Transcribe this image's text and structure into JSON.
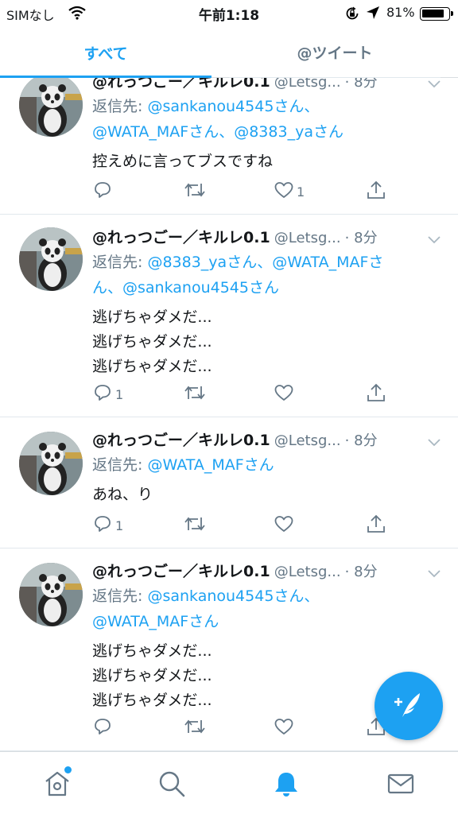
{
  "status_bar": {
    "carrier": "SIMなし",
    "time": "午前1:18",
    "battery_percent": "81%",
    "battery_level": 0.81
  },
  "tabs": [
    {
      "label": "すべて",
      "selected": true
    },
    {
      "label": "@ツイート",
      "selected": false
    }
  ],
  "tweets": [
    {
      "name": "@れっつごー／キルレ0.1",
      "handle": "@Letsg...",
      "time": "· 8分",
      "reply_prefix": "返信先: ",
      "reply_mentions": "@sankanou4545さん、",
      "reply_line2": "@WATA_MAFさん、@8383_yaさん",
      "text": "控えめに言ってブスですね",
      "reply_count": "",
      "like_count": "1"
    },
    {
      "name": "@れっつごー／キルレ0.1",
      "handle": "@Letsg...",
      "time": "· 8分",
      "reply_prefix": "返信先: ",
      "reply_mentions": "@8383_yaさん、@WATA_MAFさ",
      "reply_line2": "ん、@sankanou4545さん",
      "text_lines": [
        "逃げちゃダメだ...",
        "逃げちゃダメだ...",
        "逃げちゃダメだ..."
      ],
      "reply_count": "1",
      "like_count": ""
    },
    {
      "name": "@れっつごー／キルレ0.1",
      "handle": "@Letsg...",
      "time": "· 8分",
      "reply_prefix": "返信先: ",
      "reply_mentions": "@WATA_MAFさん",
      "text": "あね、り",
      "reply_count": "1",
      "like_count": ""
    },
    {
      "name": "@れっつごー／キルレ0.1",
      "handle": "@Letsg...",
      "time": "· 8分",
      "reply_prefix": "返信先: ",
      "reply_mentions": "@sankanou4545さん、",
      "reply_line2": "@WATA_MAFさん",
      "text_lines": [
        "逃げちゃダメだ...",
        "逃げちゃダメだ...",
        "逃げちゃダメだ..."
      ],
      "reply_count": "",
      "like_count": ""
    }
  ],
  "colors": {
    "accent": "#1da1f2",
    "secondary_text": "#657786",
    "text": "#14171a"
  },
  "icons": [
    "wifi-icon",
    "rotation-lock-icon",
    "location-arrow-icon",
    "battery-icon",
    "chevron-down-icon",
    "reply-icon",
    "retweet-icon",
    "like-icon",
    "share-icon",
    "compose-icon",
    "home-icon",
    "search-icon",
    "notifications-icon",
    "messages-icon"
  ]
}
